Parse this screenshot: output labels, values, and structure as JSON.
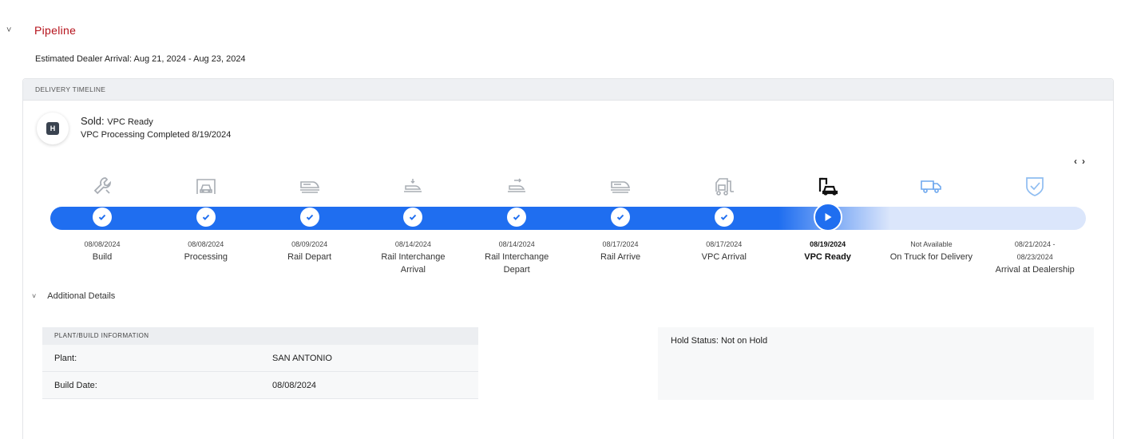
{
  "section": {
    "title": "Pipeline",
    "eta": "Estimated Dealer Arrival: Aug 21, 2024 - Aug 23, 2024"
  },
  "timeline": {
    "header": "DELIVERY TIMELINE",
    "status_badge": "H",
    "status_label": "Sold:",
    "status_value": "VPC Ready",
    "status_detail": "VPC Processing Completed 8/19/2024",
    "prev_arrow": "‹",
    "next_arrow": "›",
    "progress_fraction": 0.78,
    "stages": [
      {
        "date": "08/08/2024",
        "label": "Build",
        "state": "done",
        "icon": "wrench-icon"
      },
      {
        "date": "08/08/2024",
        "label": "Processing",
        "state": "done",
        "icon": "car-garage-icon"
      },
      {
        "date": "08/09/2024",
        "label": "Rail Depart",
        "state": "done",
        "icon": "train-icon"
      },
      {
        "date": "08/14/2024",
        "label": "Rail Interchange Arrival",
        "state": "done",
        "icon": "rail-interchange-arrival-icon"
      },
      {
        "date": "08/14/2024",
        "label": "Rail Interchange Depart",
        "state": "done",
        "icon": "rail-interchange-depart-icon"
      },
      {
        "date": "08/17/2024",
        "label": "Rail Arrive",
        "state": "done",
        "icon": "train-arrive-icon"
      },
      {
        "date": "08/17/2024",
        "label": "VPC Arrival",
        "state": "done",
        "icon": "forklift-icon"
      },
      {
        "date": "08/19/2024",
        "label": "VPC Ready",
        "state": "current",
        "icon": "vpc-ready-icon"
      },
      {
        "date": "Not Available",
        "label": "On Truck for Delivery",
        "state": "pending",
        "icon": "truck-icon"
      },
      {
        "date": "08/21/2024 - 08/23/2024",
        "label": "Arrival at Dealership",
        "state": "pending",
        "icon": "shield-check-icon"
      }
    ]
  },
  "additional_details": {
    "toggle_label": "Additional Details",
    "plant_card": {
      "header": "PLANT/BUILD INFORMATION",
      "rows": [
        {
          "key": "Plant:",
          "value": "SAN ANTONIO"
        },
        {
          "key": "Build Date:",
          "value": "08/08/2024"
        }
      ]
    },
    "hold_status": "Hold Status: Not on Hold"
  },
  "colors": {
    "accent_red": "#b5121b",
    "progress_blue": "#1f6ef0",
    "track_light": "#dbe6fb"
  }
}
